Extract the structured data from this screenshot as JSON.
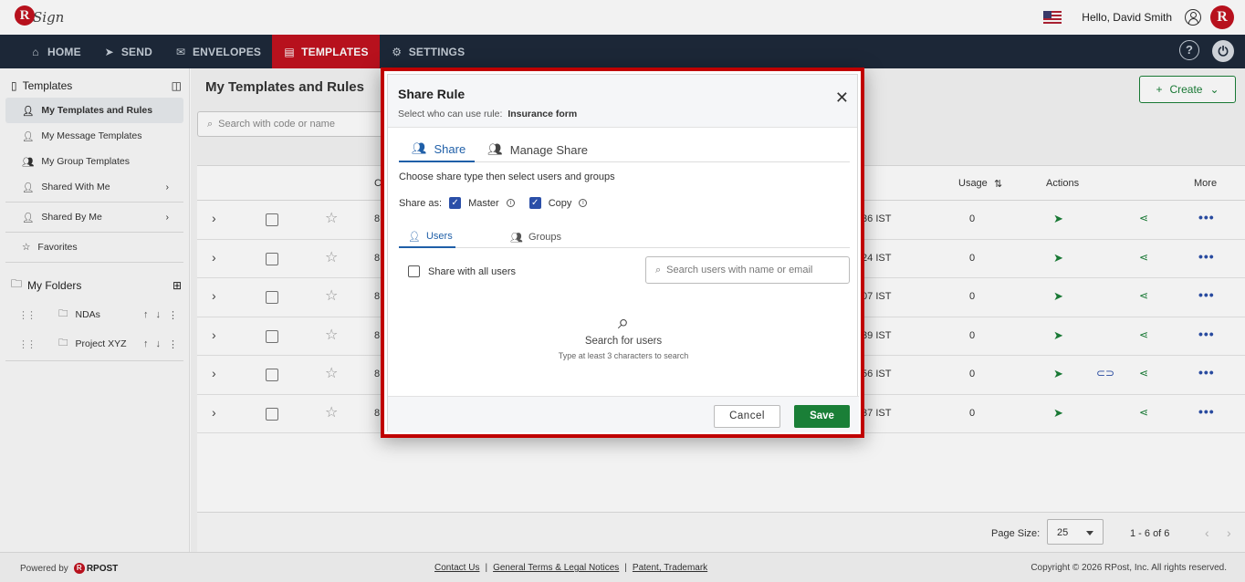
{
  "header": {
    "logo_mark": "R",
    "logo_text": "Sign",
    "greeting": "Hello, David Smith",
    "avatar_letter": "R"
  },
  "nav": {
    "items": [
      {
        "label": "HOME",
        "icon": "home-icon"
      },
      {
        "label": "SEND",
        "icon": "send-icon"
      },
      {
        "label": "ENVELOPES",
        "icon": "envelope-icon"
      },
      {
        "label": "TEMPLATES",
        "icon": "template-icon",
        "active": true
      },
      {
        "label": "SETTINGS",
        "icon": "gear-icon"
      }
    ],
    "help": "?",
    "power": "⏻"
  },
  "sidebar": {
    "title": "Templates",
    "items": [
      {
        "label": "My Templates and Rules"
      },
      {
        "label": "My Message Templates"
      },
      {
        "label": "My Group Templates"
      },
      {
        "label": "Shared With Me"
      },
      {
        "label": "Shared By Me"
      },
      {
        "label": "Favorites"
      }
    ],
    "folders_title": "My Folders",
    "folders": [
      {
        "label": "NDAs"
      },
      {
        "label": "Project XYZ"
      }
    ]
  },
  "main": {
    "title": "My Templates and Rules",
    "create_label": "Create",
    "search_placeholder": "Search with code or name",
    "columns": {
      "code": "C",
      "usage": "Usage",
      "actions": "Actions",
      "more": "More"
    },
    "rows": [
      {
        "code": "8",
        "date": ":36 IST",
        "usage": "0"
      },
      {
        "code": "8",
        "date": ":24 IST",
        "usage": "0"
      },
      {
        "code": "8",
        "date": ":07 IST",
        "usage": "0"
      },
      {
        "code": "8",
        "date": ":39 IST",
        "usage": "0"
      },
      {
        "code": "8",
        "date": ":56 IST",
        "usage": "0"
      },
      {
        "code": "8",
        "date": ":37 IST",
        "usage": "0"
      }
    ],
    "page_size_label": "Page Size:",
    "page_size": "25",
    "count": "1 - 6 of 6"
  },
  "footer": {
    "powered": "Powered by",
    "brand": "RPOST",
    "links": [
      "Contact Us",
      "General Terms & Legal Notices",
      "Patent, Trademark"
    ],
    "copyright": "Copyright © 2026 RPost, Inc. All rights reserved."
  },
  "modal": {
    "title": "Share Rule",
    "subtitle_prefix": "Select who can use rule:",
    "rule_name": "Insurance form",
    "tab_share": "Share",
    "tab_manage": "Manage Share",
    "instruction": "Choose share type then select users and groups",
    "share_as": "Share as:",
    "master": "Master",
    "copy": "Copy",
    "tab_users": "Users",
    "tab_groups": "Groups",
    "share_all": "Share with all users",
    "search_placeholder": "Search users with name or email",
    "empty_title": "Search for users",
    "empty_hint": "Type at least 3 characters to search",
    "cancel": "Cancel",
    "save": "Save"
  }
}
